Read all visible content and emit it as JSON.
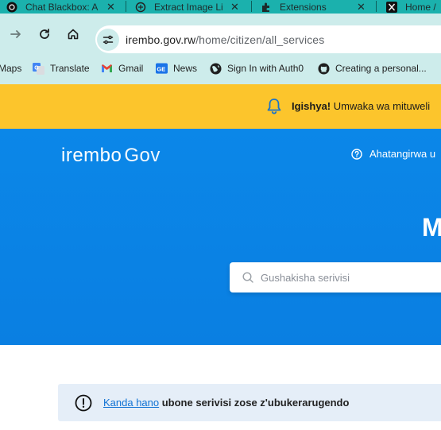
{
  "browser": {
    "tabs": [
      {
        "title": "Chat Blackbox: A",
        "icon": "blackbox-icon"
      },
      {
        "title": "Extract Image Li",
        "icon": "openai-icon"
      },
      {
        "title": "Extensions",
        "icon": "puzzle-icon"
      },
      {
        "title": "Home /",
        "icon": "x-logo-icon"
      }
    ],
    "close_glyph": "✕",
    "url_host": "irembo.gov.rw",
    "url_path": "/home/citizen/all_services",
    "bookmarks": [
      {
        "label": "Maps",
        "icon": "maps-icon"
      },
      {
        "label": "Translate",
        "icon": "google-translate-icon"
      },
      {
        "label": "Gmail",
        "icon": "gmail-icon"
      },
      {
        "label": "News",
        "icon": "google-news-icon"
      },
      {
        "label": "Sign In with Auth0",
        "icon": "globe-icon"
      },
      {
        "label": "Creating a personal...",
        "icon": "github-icon"
      }
    ]
  },
  "notice": {
    "label": "Igishya!",
    "message": " Umwaka wa mituweli"
  },
  "header": {
    "logo_main": "irembo",
    "logo_gov": "Gov",
    "help_label": "Ahatangirwa u"
  },
  "hero": {
    "title_fragment": "M",
    "search_placeholder": "Gushakisha serivisi"
  },
  "alert": {
    "link_text": "Kanda hano",
    "message": " ubone serivisi zose z'ubukerarugendo"
  },
  "colors": {
    "tab_strip": "#1bb1ad",
    "toolbar": "#cdeceb",
    "notice": "#fcc52c",
    "hero": "#0b87e8",
    "alert_bg": "#e5eef8",
    "link": "#1173d4"
  }
}
